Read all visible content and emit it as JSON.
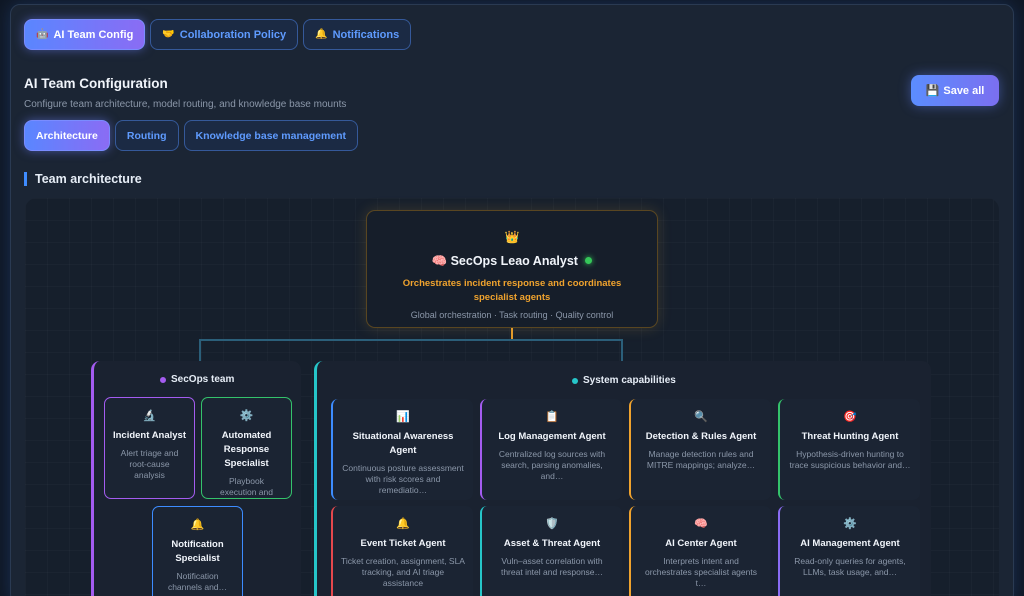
{
  "top_tabs": [
    {
      "icon": "🤖",
      "label": "AI Team Config",
      "active": true
    },
    {
      "icon": "🤝",
      "label": "Collaboration Policy",
      "active": false
    },
    {
      "icon": "🔔",
      "label": "Notifications",
      "active": false
    }
  ],
  "header": {
    "title": "AI Team Configuration",
    "subtitle": "Configure team architecture, model routing, and knowledge base mounts",
    "save_icon": "💾",
    "save_label": "Save all"
  },
  "sub_tabs": [
    {
      "label": "Architecture",
      "active": true
    },
    {
      "label": "Routing",
      "active": false
    },
    {
      "label": "Knowledge base management",
      "active": false
    }
  ],
  "section_title": "Team architecture",
  "lead": {
    "crown_icon": "👑",
    "icon": "🧠",
    "name": "SecOps Leao Analyst",
    "status": "online",
    "description": "Orchestrates incident response and coordinates specialist agents",
    "meta": "Global orchestration · Task routing · Quality control"
  },
  "secops_team": {
    "label": "SecOps team",
    "accent": "#a45cf0",
    "members": [
      {
        "icon": "🔬",
        "name": "Incident Analyst",
        "desc": "Alert triage and root-cause analysis",
        "color": "#a45cf0"
      },
      {
        "icon": "⚙️",
        "name": "Automated Response Specialist",
        "desc": "Playbook execution and change-relate…",
        "color": "#34c26b"
      },
      {
        "icon": "🔔",
        "name": "Notification Specialist",
        "desc": "Notification channels and…",
        "color": "#3d8cff"
      }
    ]
  },
  "system_capabilities": {
    "label": "System capabilities",
    "accent": "#26c6c9",
    "agents": [
      {
        "icon": "📊",
        "name": "Situational Awareness Agent",
        "desc": "Continuous posture assessment with risk scores and remediatio…",
        "color": "#3d8cff"
      },
      {
        "icon": "📋",
        "name": "Log Management Agent",
        "desc": "Centralized log sources with search, parsing anomalies, and…",
        "color": "#a45cf0"
      },
      {
        "icon": "🔍",
        "name": "Detection & Rules Agent",
        "desc": "Manage detection rules and MITRE mappings; analyze…",
        "color": "#f0a32e"
      },
      {
        "icon": "🎯",
        "name": "Threat Hunting Agent",
        "desc": "Hypothesis-driven hunting to trace suspicious behavior and…",
        "color": "#34c26b"
      },
      {
        "icon": "🔔",
        "name": "Event Ticket Agent",
        "desc": "Ticket creation, assignment, SLA tracking, and AI triage assistance",
        "color": "#e5484d"
      },
      {
        "icon": "🛡️",
        "name": "Asset & Threat Agent",
        "desc": "Vuln–asset correlation with threat intel and response…",
        "color": "#26c6c9"
      },
      {
        "icon": "🧠",
        "name": "AI Center Agent",
        "desc": "Interprets intent and orchestrates specialist agents t…",
        "color": "#f0a32e"
      },
      {
        "icon": "⚙️",
        "name": "AI Management Agent",
        "desc": "Read-only queries for agents, LLMs, task usage, and…",
        "color": "#8a6cf4"
      }
    ]
  }
}
